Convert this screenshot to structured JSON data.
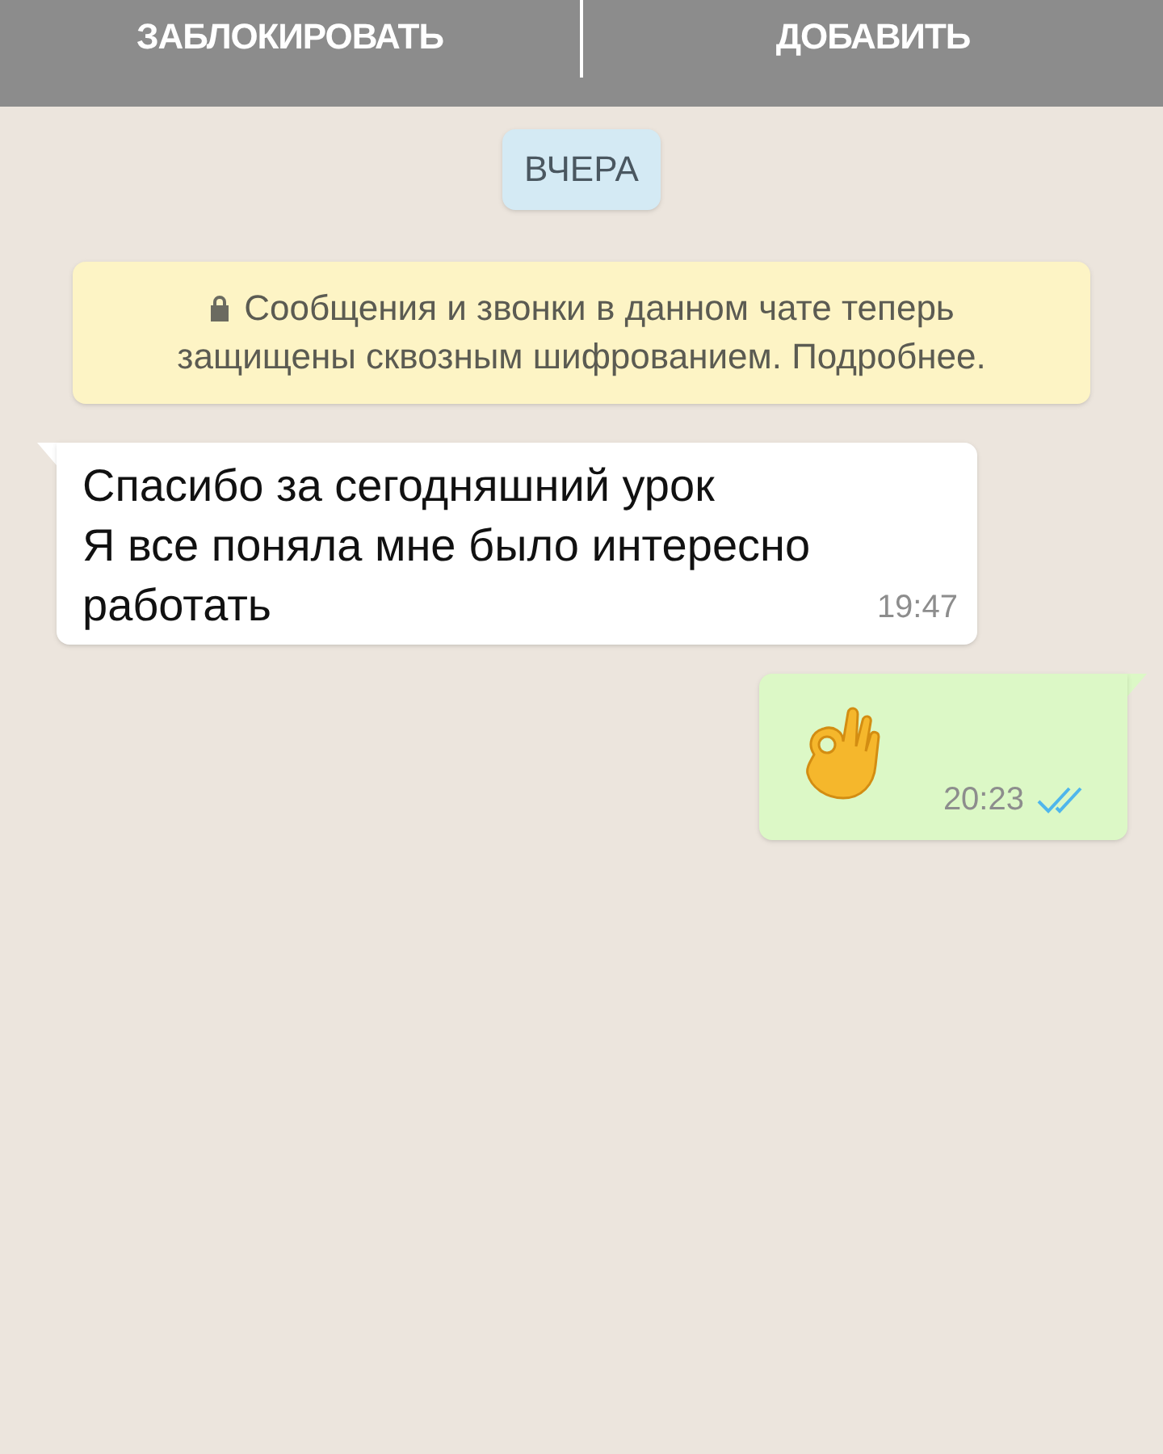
{
  "action_bar": {
    "buttons": [
      "ЗАБЛОКИРОВАТЬ",
      "ДОБАВИТЬ"
    ]
  },
  "date_chip": "ВЧЕРА",
  "encryption_notice": {
    "text": "Сообщения и звонки в данном чате теперь защищены сквозным шифрованием. Подробнее."
  },
  "messages": [
    {
      "kind": "incoming",
      "lines": [
        "Спасибо за сегодняшний урок",
        "Я все поняла мне было интересно",
        "работать"
      ],
      "time": "19:47"
    },
    {
      "kind": "outgoing",
      "time": "20:23",
      "read": true
    }
  ]
}
